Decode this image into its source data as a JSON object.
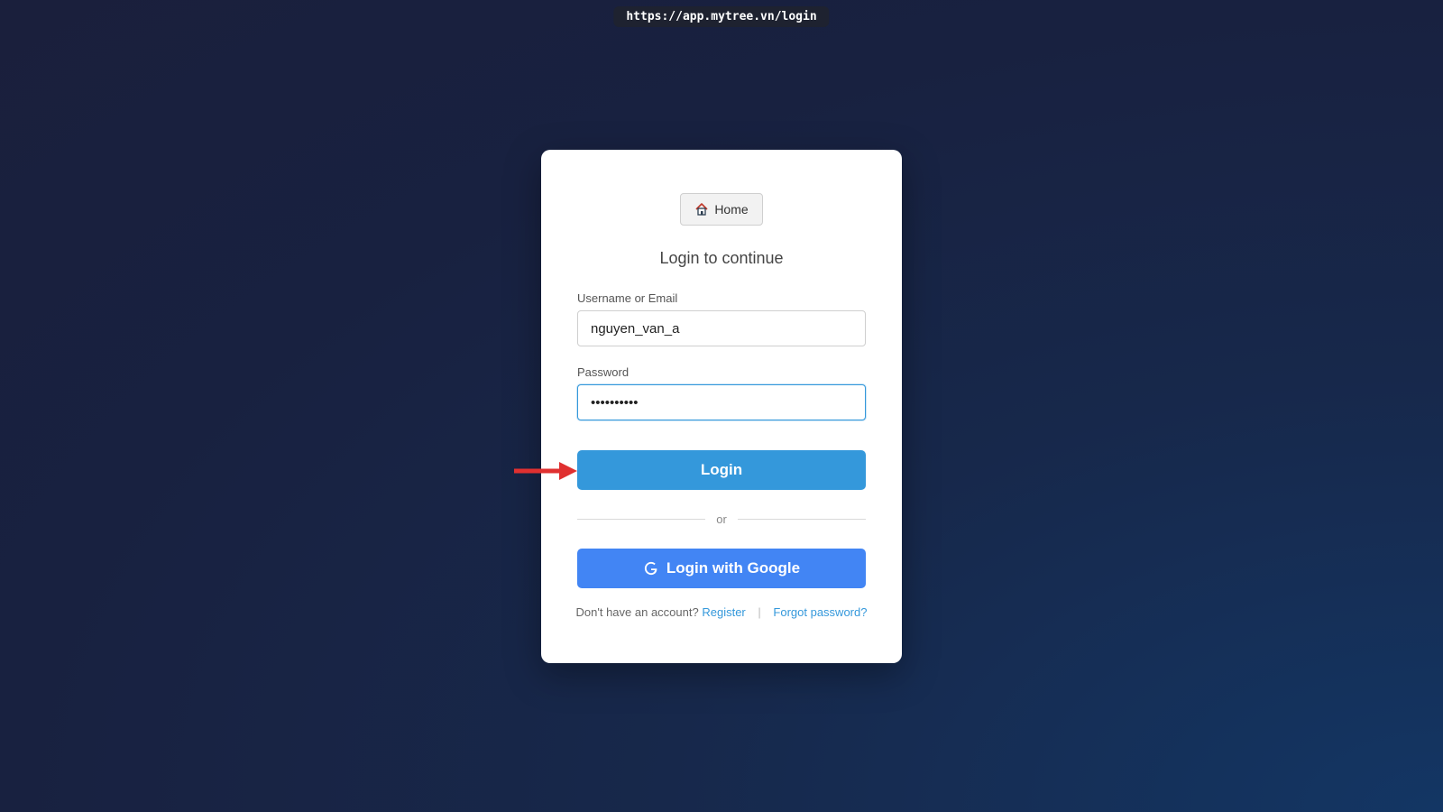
{
  "browser": {
    "url": "https://app.mytree.vn/login"
  },
  "login_card": {
    "home_button_label": "Home",
    "subtitle": "Login to continue",
    "username_label": "Username or Email",
    "username_value": "nguyen_van_a",
    "password_label": "Password",
    "password_value": "password12",
    "login_button_label": "Login",
    "divider_text": "or",
    "google_button_label": "Login with Google",
    "no_account_text": "Don't have an account?",
    "register_link": "Register",
    "separator": "|",
    "forgot_password_link": "Forgot password?"
  },
  "icons": {
    "home": "home-icon",
    "google": "google-icon",
    "annotation_arrow": "arrow-right-icon"
  },
  "colors": {
    "primary": "#3498db",
    "google_blue": "#4285f4",
    "arrow_red": "#e03030"
  }
}
